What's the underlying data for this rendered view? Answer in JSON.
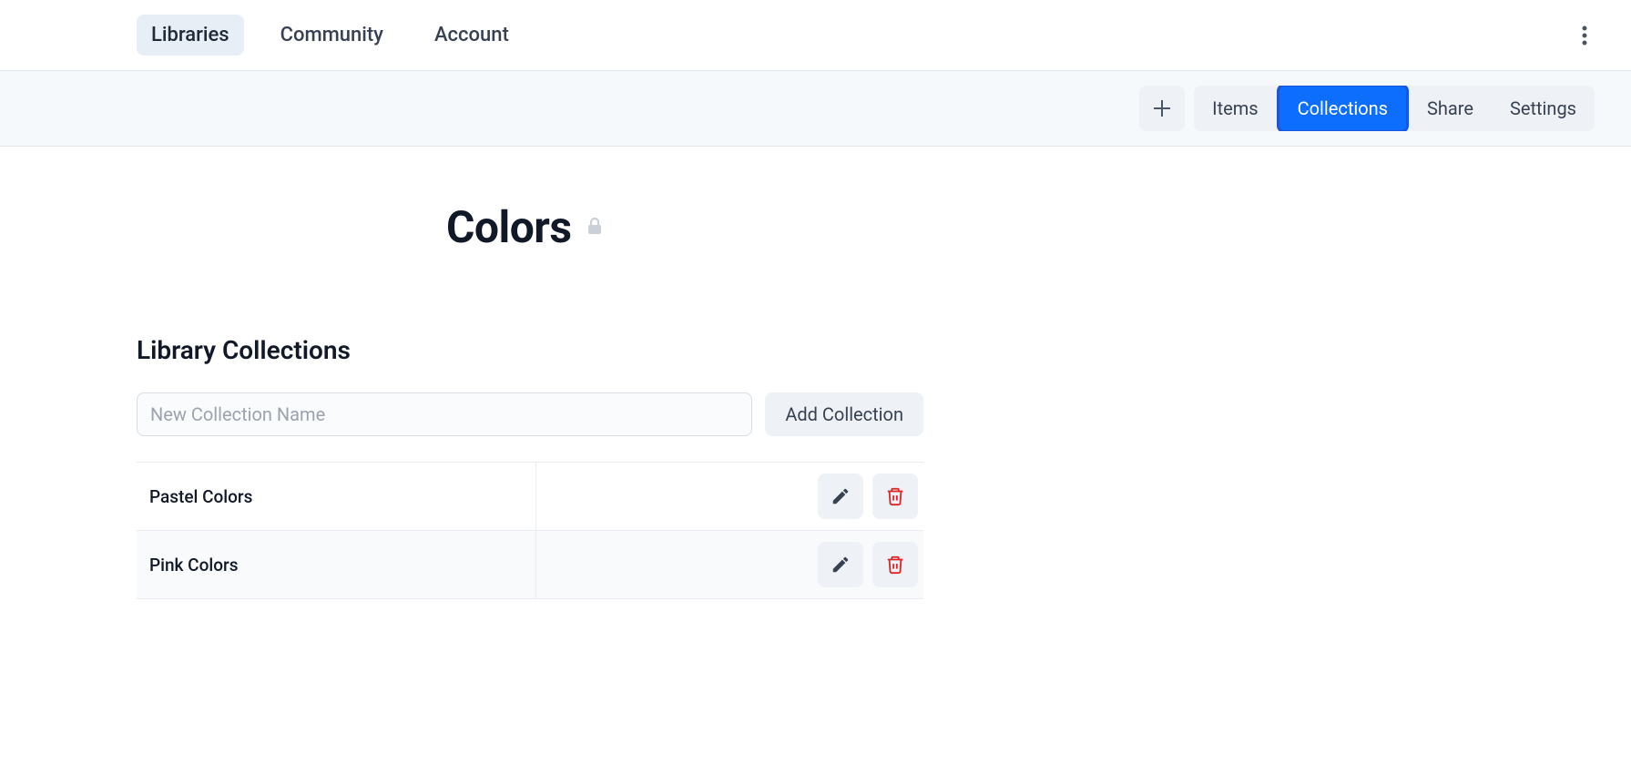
{
  "nav": {
    "items": [
      {
        "label": "Libraries",
        "active": true
      },
      {
        "label": "Community",
        "active": false
      },
      {
        "label": "Account",
        "active": false
      }
    ]
  },
  "subnav": {
    "tabs": [
      {
        "label": "Items",
        "active": false
      },
      {
        "label": "Collections",
        "active": true
      },
      {
        "label": "Share",
        "active": false
      },
      {
        "label": "Settings",
        "active": false
      }
    ]
  },
  "page": {
    "title": "Colors",
    "section_title": "Library Collections",
    "input_placeholder": "New Collection Name",
    "add_button_label": "Add Collection"
  },
  "collections": [
    {
      "name": "Pastel Colors"
    },
    {
      "name": "Pink Colors"
    }
  ]
}
